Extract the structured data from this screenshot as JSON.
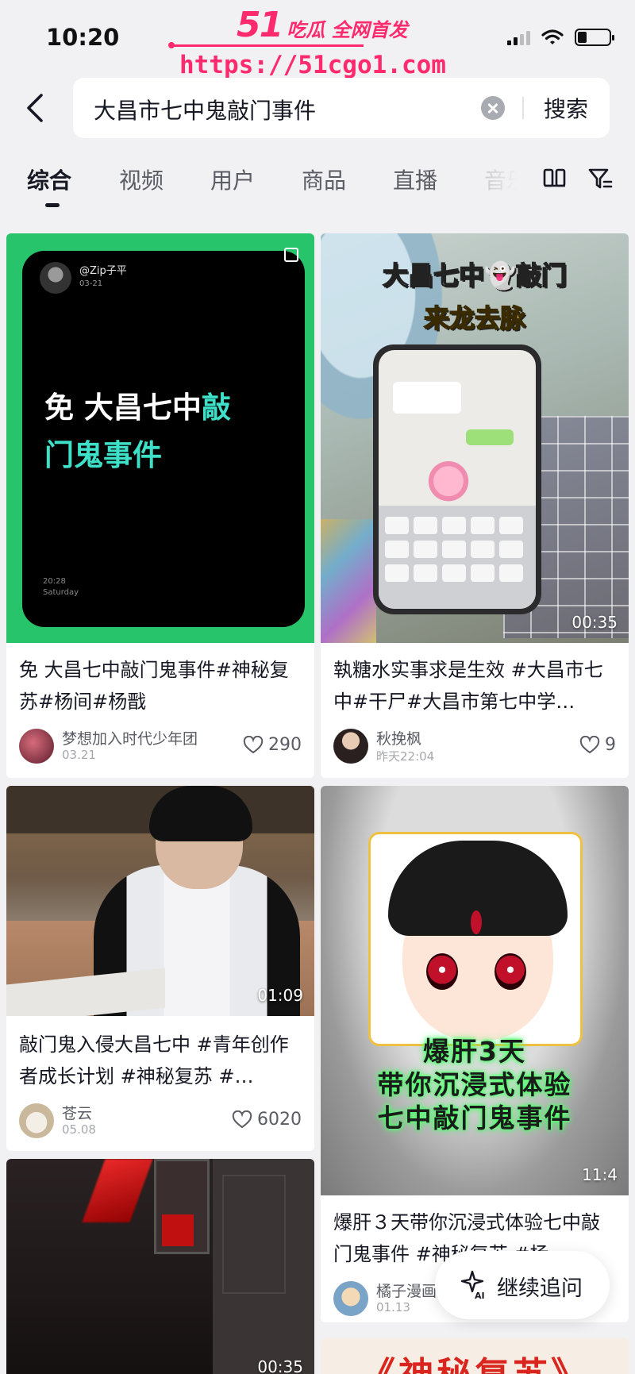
{
  "status_bar": {
    "time": "10:20"
  },
  "watermark": {
    "number": "51",
    "tagline": "吃瓜 全网首发",
    "url": "https://51cgo1.com"
  },
  "search": {
    "query": "大昌市七中鬼敲门事件",
    "submit_label": "搜索"
  },
  "tabs": [
    {
      "label": "综合",
      "active": true
    },
    {
      "label": "视频",
      "active": false
    },
    {
      "label": "用户",
      "active": false
    },
    {
      "label": "商品",
      "active": false
    },
    {
      "label": "直播",
      "active": false
    },
    {
      "label": "音乐",
      "active": false
    }
  ],
  "toolbar_icons": [
    "layout-toggle-icon",
    "filter-icon"
  ],
  "cards": [
    {
      "thumb": {
        "user": "@Zip子平",
        "date": "03-21",
        "title_line1": "免 大昌七中",
        "title_hl1": "敲",
        "title_hl2": "门鬼事件",
        "clock": "20:28",
        "weekday": "Saturday"
      },
      "title": "免 大昌七中敲门鬼事件#神秘复苏#杨间#杨戬",
      "author": "梦想加入时代少年团",
      "date": "03.21",
      "likes": "290"
    },
    {
      "thumb": {
        "title": "大昌七中👻敲门",
        "subtitle": "来龙去脉"
      },
      "duration": "00:35",
      "title": "執糖水实事求是生效 #大昌市七中#干尸#大昌市第七中学…",
      "author": "秋挽枫",
      "date": "昨天22:04",
      "likes": "9"
    },
    {
      "duration": "01:09",
      "title": "敲门鬼入侵大昌七中 #青年创作者成长计划 #神秘复苏 #…",
      "author": "苍云",
      "date": "05.08",
      "likes": "6020"
    },
    {
      "thumb": {
        "caption1": "爆肝3天",
        "caption2": "带你沉浸式体验",
        "caption3": "七中敲门鬼事件"
      },
      "duration": "11:4",
      "title": "爆肝３天带你沉浸式体验七中敲门鬼事件 #神秘复苏 #杨",
      "author": "橘子漫画",
      "date": "01.13"
    },
    {
      "duration": "00:35"
    },
    {
      "thumb": {
        "title": "《神秘复苏》"
      }
    }
  ],
  "ai_button": {
    "label": "继续追问"
  },
  "colors": {
    "accent": "#ff2a6d",
    "green_card": "#27c46b",
    "highlight_teal": "#3fe0c8"
  }
}
